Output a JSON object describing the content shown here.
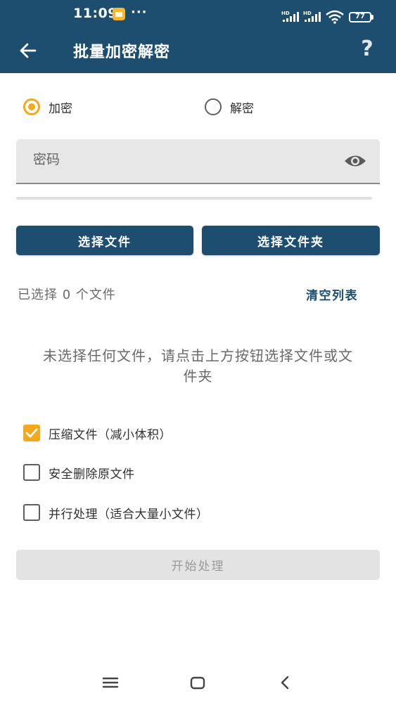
{
  "status_bar": {
    "time": "11:09",
    "dots": "···",
    "battery": "77",
    "icons": [
      "notification-icon",
      "signal-hd-icon",
      "signal-hd-icon",
      "wifi-icon",
      "battery-icon"
    ]
  },
  "app_bar": {
    "title": "批量加密解密",
    "help": "?"
  },
  "mode": {
    "encrypt_label": "加密",
    "decrypt_label": "解密",
    "selected": "encrypt"
  },
  "password": {
    "placeholder": "密码",
    "value": ""
  },
  "buttons": {
    "select_file": "选择文件",
    "select_folder": "选择文件夹",
    "start": "开始处理"
  },
  "file_list": {
    "selected_count": "已选择 0 个文件",
    "clear": "清空列表",
    "empty_message": "未选择任何文件，请点击上方按钮选择文件或文件夹"
  },
  "options": {
    "compress": {
      "label": "压缩文件（减小体积）",
      "checked": true
    },
    "secure_delete": {
      "label": "安全删除原文件",
      "checked": false
    },
    "parallel": {
      "label": "并行处理（适合大量小文件）",
      "checked": false
    }
  },
  "colors": {
    "primary": "#1d4e6f",
    "accent": "#f3a81d"
  }
}
